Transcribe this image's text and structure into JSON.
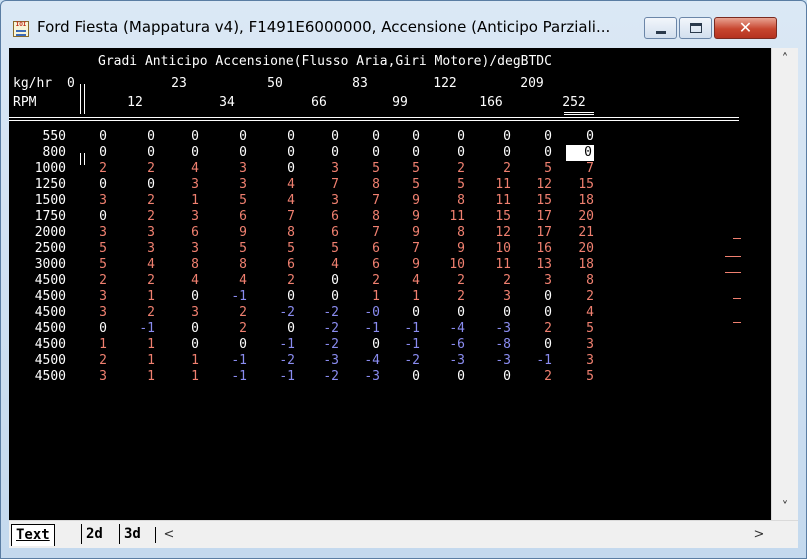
{
  "window": {
    "title": "Ford Fiesta (Mappatura v4), F1491E6000000, Accensione (Anticipo Parziali...",
    "app_icon_text": "IOI",
    "minimize_icon": "minimize-icon",
    "maximize_icon": "maximize-icon",
    "close_icon": "close-icon",
    "close_glyph": "✕"
  },
  "map": {
    "title": "Gradi Anticipo Accensione(Flusso Aria,Giri Motore)/degBTDC",
    "x_axis_label": "kg/hr",
    "y_axis_label": "RPM",
    "columns": [
      "0",
      "12",
      "23",
      "34",
      "50",
      "66",
      "83",
      "99",
      "122",
      "166",
      "209",
      "252"
    ],
    "rows": [
      "550",
      "800",
      "1000",
      "1250",
      "1500",
      "1750",
      "2000",
      "2500",
      "3000",
      "4500",
      "4500",
      "4500",
      "4500",
      "4500",
      "4500",
      "4500"
    ],
    "cells": [
      [
        "0",
        "0",
        "0",
        "0",
        "0",
        "0",
        "0",
        "0",
        "0",
        "0",
        "0",
        "0"
      ],
      [
        "0",
        "0",
        "0",
        "0",
        "0",
        "0",
        "0",
        "0",
        "0",
        "0",
        "0",
        "0"
      ],
      [
        "2",
        "2",
        "4",
        "3",
        "0",
        "3",
        "5",
        "5",
        "2",
        "2",
        "5",
        "7"
      ],
      [
        "0",
        "0",
        "3",
        "3",
        "4",
        "7",
        "8",
        "5",
        "5",
        "11",
        "12",
        "15"
      ],
      [
        "3",
        "2",
        "1",
        "5",
        "4",
        "3",
        "7",
        "9",
        "8",
        "11",
        "15",
        "18"
      ],
      [
        "0",
        "2",
        "3",
        "6",
        "7",
        "6",
        "8",
        "9",
        "11",
        "15",
        "17",
        "20"
      ],
      [
        "3",
        "3",
        "6",
        "9",
        "8",
        "6",
        "7",
        "9",
        "8",
        "12",
        "17",
        "21"
      ],
      [
        "5",
        "3",
        "3",
        "5",
        "5",
        "5",
        "6",
        "7",
        "9",
        "10",
        "16",
        "20"
      ],
      [
        "5",
        "4",
        "8",
        "8",
        "6",
        "4",
        "6",
        "9",
        "10",
        "11",
        "13",
        "18"
      ],
      [
        "2",
        "2",
        "4",
        "4",
        "2",
        "0",
        "2",
        "4",
        "2",
        "2",
        "3",
        "8"
      ],
      [
        "3",
        "1",
        "0",
        "-1",
        "0",
        "0",
        "1",
        "1",
        "2",
        "3",
        "0",
        "2"
      ],
      [
        "3",
        "2",
        "3",
        "2",
        "-2",
        "-2",
        "-0",
        "0",
        "0",
        "0",
        "0",
        "4"
      ],
      [
        "0",
        "-1",
        "0",
        "2",
        "0",
        "-2",
        "-1",
        "-1",
        "-4",
        "-3",
        "2",
        "5"
      ],
      [
        "1",
        "1",
        "0",
        "0",
        "-1",
        "-2",
        "0",
        "-1",
        "-6",
        "-8",
        "0",
        "3"
      ],
      [
        "2",
        "1",
        "1",
        "-1",
        "-2",
        "-3",
        "-4",
        "-2",
        "-3",
        "-3",
        "-1",
        "3"
      ],
      [
        "3",
        "1",
        "1",
        "-1",
        "-1",
        "-2",
        "-3",
        "0",
        "0",
        "0",
        "2",
        "5"
      ]
    ],
    "selected": {
      "row": 1,
      "col": 11
    },
    "colors": {
      "white": "#ffffff",
      "positive": "#f08070",
      "negative": "#8a8cf0"
    }
  },
  "scrollbar": {
    "up_glyph": "˄",
    "down_glyph": "˅",
    "left_glyph": "<",
    "right_glyph": ">"
  },
  "tabs": [
    {
      "label": "Text",
      "active": true
    },
    {
      "label": "2d",
      "active": false
    },
    {
      "label": "3d",
      "active": false
    }
  ]
}
